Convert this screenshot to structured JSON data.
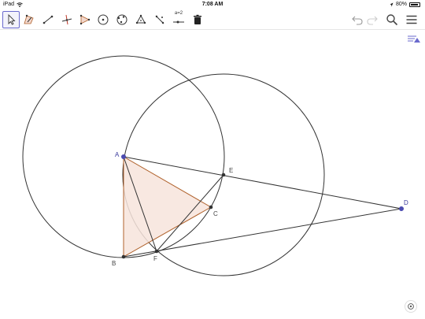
{
  "status": {
    "device": "iPad",
    "time": "7:08 AM",
    "battery": "80%"
  },
  "toolbar": {
    "relation_label": "a=2",
    "tools": [
      {
        "name": "move-tool"
      },
      {
        "name": "freehand-shape-tool"
      },
      {
        "name": "line-tool"
      },
      {
        "name": "perpendicular-line-tool"
      },
      {
        "name": "polygon-tool"
      },
      {
        "name": "circle-center-point-tool"
      },
      {
        "name": "circle-three-points-tool"
      },
      {
        "name": "angle-tool"
      },
      {
        "name": "reflect-tool"
      },
      {
        "name": "slider-tool"
      },
      {
        "name": "delete-tool"
      }
    ]
  },
  "colors": {
    "accent": "#6a6acd",
    "point_blue": "#4b4bb0",
    "triangle_edge": "#b0622c",
    "triangle_fill": "#f7e4dc"
  },
  "points": {
    "A": "A",
    "B": "B",
    "C": "C",
    "D": "D",
    "E": "E",
    "F": "F"
  }
}
